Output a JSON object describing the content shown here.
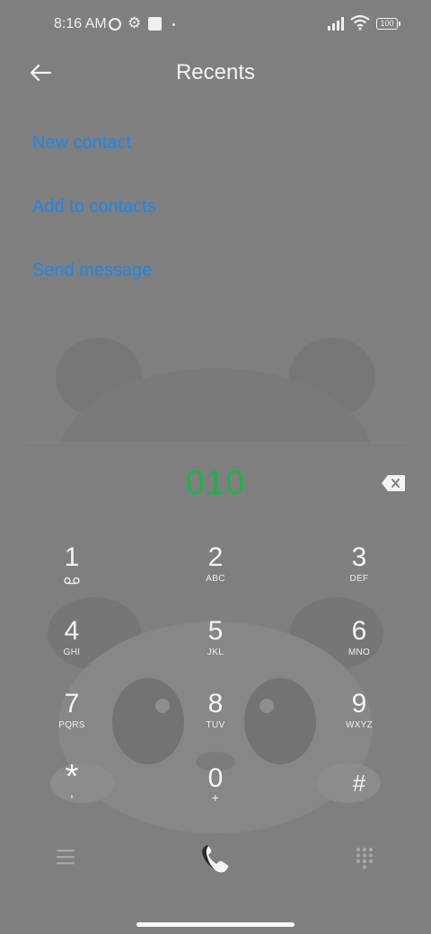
{
  "status_bar": {
    "time": "8:16 AM",
    "battery": "100",
    "icons": [
      "data-saver-icon",
      "gear-icon",
      "square-notification-icon",
      "dot-icon",
      "signal-icon",
      "wifi-icon",
      "battery-icon"
    ]
  },
  "header": {
    "title": "Recents",
    "back_icon": "back-arrow-icon"
  },
  "actions": {
    "new_contact": "New contact",
    "add_to_contacts": "Add to contacts",
    "send_message": "Send message"
  },
  "dialer": {
    "number": "010",
    "backspace_icon": "backspace-icon",
    "keys": [
      {
        "digit": "1",
        "letters": ""
      },
      {
        "digit": "2",
        "letters": "ABC"
      },
      {
        "digit": "3",
        "letters": "DEF"
      },
      {
        "digit": "4",
        "letters": "GHI"
      },
      {
        "digit": "5",
        "letters": "JKL"
      },
      {
        "digit": "6",
        "letters": "MNO"
      },
      {
        "digit": "7",
        "letters": "PQRS"
      },
      {
        "digit": "8",
        "letters": "TUV"
      },
      {
        "digit": "9",
        "letters": "WXYZ"
      },
      {
        "digit": "*",
        "letters": ","
      },
      {
        "digit": "0",
        "letters": "+"
      },
      {
        "digit": "#",
        "letters": ""
      }
    ]
  },
  "bottom_bar": {
    "icons": [
      "menu-icon",
      "call-icon",
      "dialpad-icon"
    ]
  },
  "colors": {
    "background": "#7f7f7f",
    "link": "#1f86e8",
    "number": "#1fb24a",
    "text": "#f4f4f4"
  }
}
